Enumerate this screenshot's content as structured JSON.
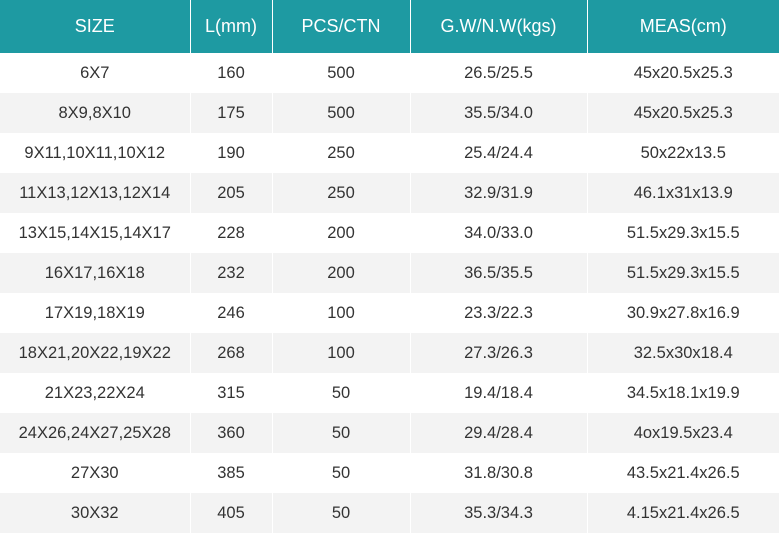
{
  "table": {
    "headers": [
      "SIZE",
      "L(mm)",
      "PCS/CTN",
      "G.W/N.W(kgs)",
      "MEAS(cm)"
    ],
    "rows": [
      [
        "6X7",
        "160",
        "500",
        "26.5/25.5",
        "45x20.5x25.3"
      ],
      [
        "8X9,8X10",
        "175",
        "500",
        "35.5/34.0",
        "45x20.5x25.3"
      ],
      [
        "9X11,10X11,10X12",
        "190",
        "250",
        "25.4/24.4",
        "50x22x13.5"
      ],
      [
        "11X13,12X13,12X14",
        "205",
        "250",
        "32.9/31.9",
        "46.1x31x13.9"
      ],
      [
        "13X15,14X15,14X17",
        "228",
        "200",
        "34.0/33.0",
        "51.5x29.3x15.5"
      ],
      [
        "16X17,16X18",
        "232",
        "200",
        "36.5/35.5",
        "51.5x29.3x15.5"
      ],
      [
        "17X19,18X19",
        "246",
        "100",
        "23.3/22.3",
        "30.9x27.8x16.9"
      ],
      [
        "18X21,20X22,19X22",
        "268",
        "100",
        "27.3/26.3",
        "32.5x30x18.4"
      ],
      [
        "21X23,22X24",
        "315",
        "50",
        "19.4/18.4",
        "34.5x18.1x19.9"
      ],
      [
        "24X26,24X27,25X28",
        "360",
        "50",
        "29.4/28.4",
        "4ox19.5x23.4"
      ],
      [
        "27X30",
        "385",
        "50",
        "31.8/30.8",
        "43.5x21.4x26.5"
      ],
      [
        "30X32",
        "405",
        "50",
        "35.3/34.3",
        "4.15x21.4x26.5"
      ]
    ]
  },
  "colors": {
    "header_bg": "#1e9aa2",
    "header_text": "#ffffff",
    "row_alt_bg": "#f3f3f3",
    "cell_text": "#333333"
  }
}
